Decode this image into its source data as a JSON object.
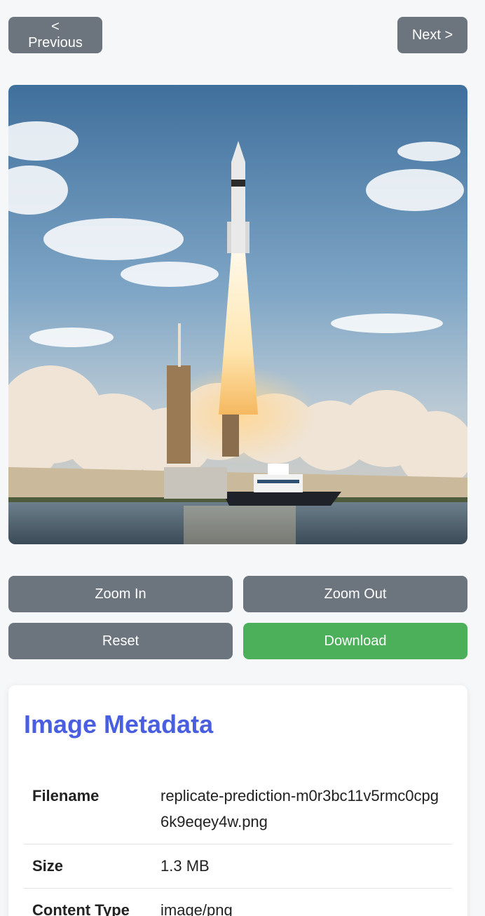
{
  "nav": {
    "previous_label": "< Previous",
    "next_label": "Next >"
  },
  "image": {
    "subject": "rocket launch over water with tugboat"
  },
  "controls": {
    "zoom_in": "Zoom In",
    "zoom_out": "Zoom Out",
    "reset": "Reset",
    "download": "Download"
  },
  "metadata": {
    "title": "Image Metadata",
    "rows": [
      {
        "key": "Filename",
        "value": "replicate-prediction-m0r3bc11v5rmc0cpg6k9eqey4w.png"
      },
      {
        "key": "Size",
        "value": "1.3 MB"
      },
      {
        "key": "Content Type",
        "value": "image/png"
      }
    ]
  },
  "colors": {
    "button_gray": "#6c757d",
    "download_green": "#4caf5a",
    "title_blue": "#4a5ee0",
    "page_bg": "#f6f7f9"
  }
}
